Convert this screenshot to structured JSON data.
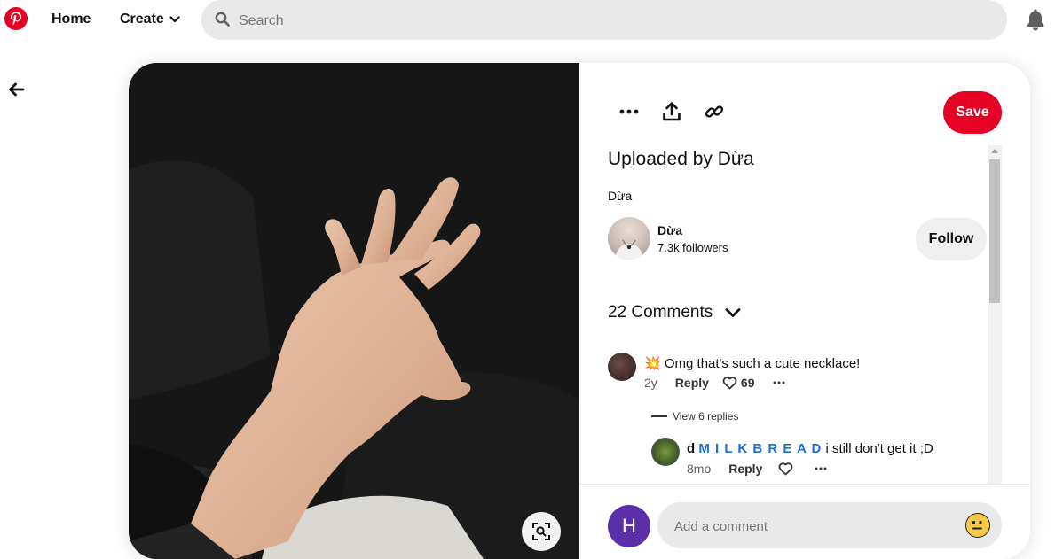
{
  "nav": {
    "home": "Home",
    "create": "Create",
    "search_placeholder": "Search"
  },
  "pin": {
    "actions": [
      "more-options",
      "share",
      "copy-link"
    ],
    "save_label": "Save",
    "title": "Uploaded by Dừa",
    "description": "Dừa",
    "creator": {
      "name": "Dừa",
      "followers": "7.3k followers"
    },
    "follow_label": "Follow"
  },
  "comments": {
    "title": "22 Comments",
    "items": [
      {
        "emoji": "💥",
        "text": "Omg that's such a cute necklace!",
        "age": "2y",
        "reply_label": "Reply",
        "likes": "69"
      }
    ],
    "view_replies": "View 6 replies",
    "replies": [
      {
        "author": "d",
        "author_styled": "M I L K B R E A D",
        "text": "i still don't get it ;D",
        "age": "8mo",
        "reply_label": "Reply"
      }
    ],
    "input_placeholder": "Add a comment",
    "current_user_initial": "H"
  },
  "colors": {
    "brand": "#e60023",
    "user_avatar": "#5b2fa8",
    "styled_name": "#1d6fd6"
  },
  "icons": [
    "pinterest-logo",
    "chevron-down-icon",
    "search-icon",
    "bell-icon",
    "back-arrow-icon",
    "ellipsis-icon",
    "share-icon",
    "link-icon",
    "visual-search-icon",
    "heart-icon",
    "emoji-icon"
  ]
}
